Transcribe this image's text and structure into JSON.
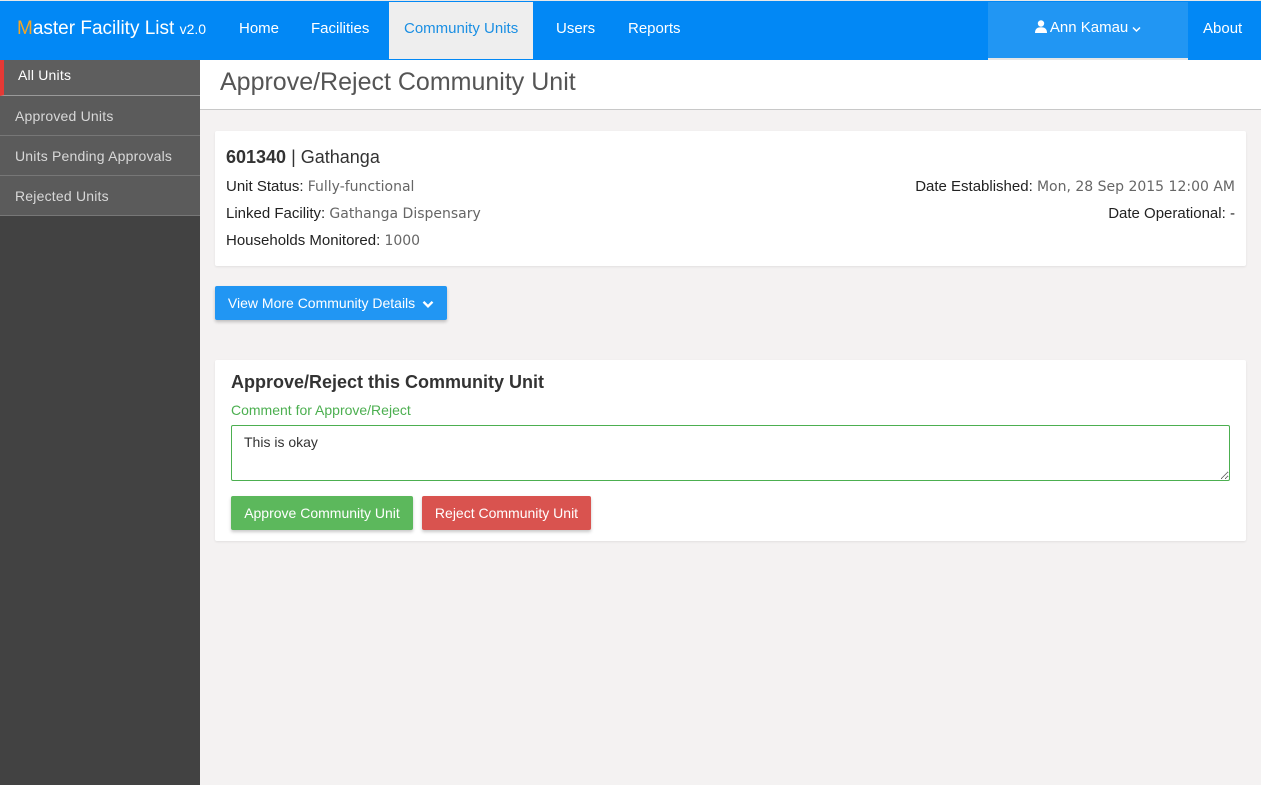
{
  "navbar": {
    "brand_first_letter": "M",
    "brand_rest": "aster Facility List",
    "brand_version": "v2.0",
    "items": [
      {
        "label": "Home"
      },
      {
        "label": "Facilities"
      },
      {
        "label": "Community Units"
      },
      {
        "label": "Users"
      },
      {
        "label": "Reports"
      }
    ],
    "active_item": "Community Units",
    "user_name": "Ann Kamau",
    "about_label": "About"
  },
  "sidebar": {
    "items": [
      {
        "label": "All Units"
      },
      {
        "label": "Approved Units"
      },
      {
        "label": "Units Pending Approvals"
      },
      {
        "label": "Rejected Units"
      }
    ],
    "active_item": "All Units"
  },
  "page": {
    "title": "Approve/Reject Community Unit"
  },
  "unit": {
    "code": "601340",
    "separator": " | ",
    "name": "Gathanga",
    "status_label": "Unit Status:",
    "status_value": "Fully-functional",
    "linked_facility_label": "Linked Facility:",
    "linked_facility_value": "Gathanga Dispensary",
    "households_label": "Households Monitored:",
    "households_value": "1000",
    "date_established_label": "Date Established:",
    "date_established_value": "Mon, 28 Sep 2015 12:00 AM",
    "date_operational_label": "Date Operational:",
    "date_operational_value": "-"
  },
  "view_more_label": "View More Community Details",
  "approval": {
    "title": "Approve/Reject this Community Unit",
    "comment_label": "Comment for Approve/Reject",
    "comment_value": "This is okay",
    "approve_label": "Approve Community Unit",
    "reject_label": "Reject Community Unit"
  },
  "colors": {
    "navbar": "#0288f5",
    "brand_accent": "#f5a623",
    "primary_button": "#2196f3",
    "approve": "#5cb85c",
    "reject": "#d9534f",
    "sidebar": "#424242",
    "sidebar_active_marker": "#e53935"
  },
  "icons": {
    "user": "user-icon",
    "user_menu_caret": "chevron-down-icon",
    "view_more_caret": "chevron-down-icon"
  }
}
